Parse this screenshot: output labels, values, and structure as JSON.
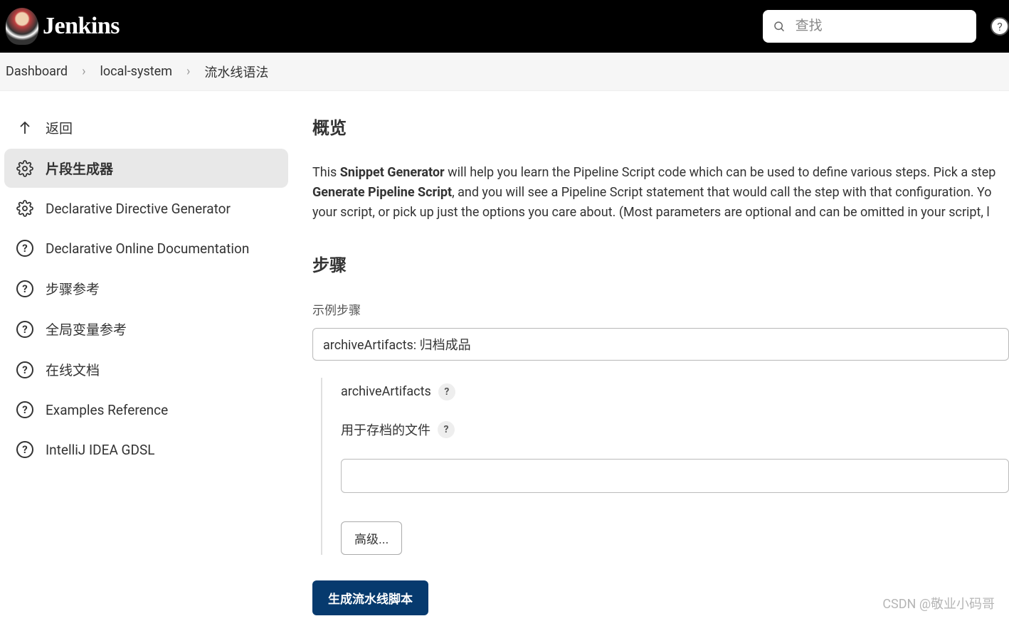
{
  "header": {
    "brand": "Jenkins",
    "search_placeholder": "查找"
  },
  "breadcrumb": {
    "items": [
      "Dashboard",
      "local-system",
      "流水线语法"
    ]
  },
  "sidebar": {
    "items": [
      {
        "label": "返回",
        "icon": "arrow-up"
      },
      {
        "label": "片段生成器",
        "icon": "gear",
        "active": true
      },
      {
        "label": "Declarative Directive Generator",
        "icon": "gear"
      },
      {
        "label": "Declarative Online Documentation",
        "icon": "help"
      },
      {
        "label": "步骤参考",
        "icon": "help"
      },
      {
        "label": "全局变量参考",
        "icon": "help"
      },
      {
        "label": "在线文档",
        "icon": "help"
      },
      {
        "label": "Examples Reference",
        "icon": "help"
      },
      {
        "label": "IntelliJ IDEA GDSL",
        "icon": "help"
      }
    ]
  },
  "content": {
    "heading_overview": "概览",
    "description_prefix": "This ",
    "description_bold1": "Snippet Generator",
    "description_mid1": " will help you learn the Pipeline Script code which can be used to define various steps. Pick a step ",
    "description_bold2": "Generate Pipeline Script",
    "description_mid2": ", and you will see a Pipeline Script statement that would call the step with that configuration. Yo",
    "description_end": " your script, or pick up just the options you care about. (Most parameters are optional and can be omitted in your script, l",
    "heading_steps": "步骤",
    "sample_step_label": "示例步骤",
    "sample_step_value": "archiveArtifacts: 归档成品",
    "form": {
      "archive_label": "archiveArtifacts",
      "files_label": "用于存档的文件",
      "files_value": "",
      "advanced_label": "高级...",
      "generate_button": "生成流水线脚本"
    }
  },
  "watermark": "CSDN @敬业小码哥"
}
